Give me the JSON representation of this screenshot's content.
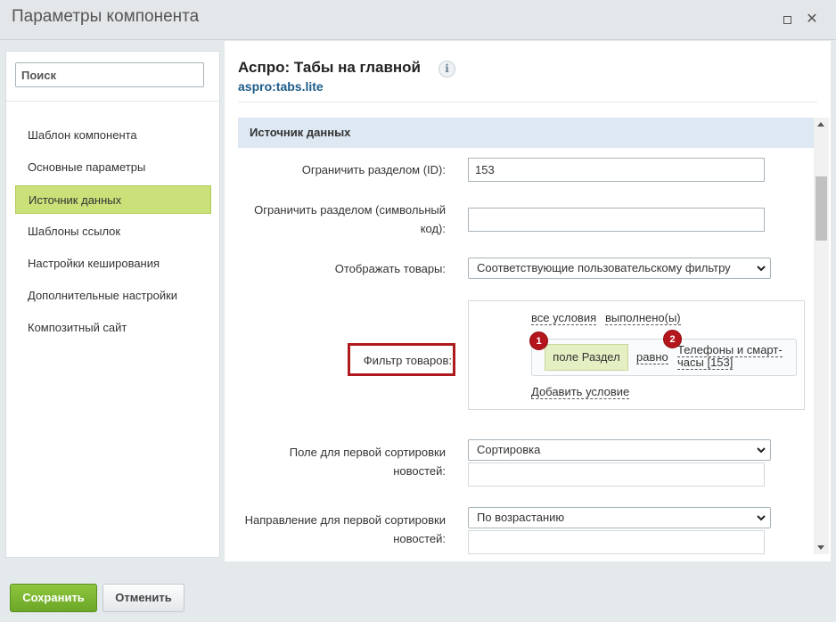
{
  "window": {
    "title": "Параметры компонента"
  },
  "sidebar": {
    "search_placeholder": "Поиск",
    "items": [
      {
        "label": "Шаблон компонента",
        "active": false
      },
      {
        "label": "Основные параметры",
        "active": false
      },
      {
        "label": "Источник данных",
        "active": true
      },
      {
        "label": "Шаблоны ссылок",
        "active": false
      },
      {
        "label": "Настройки кеширования",
        "active": false
      },
      {
        "label": "Дополнительные настройки",
        "active": false
      },
      {
        "label": "Композитный сайт",
        "active": false
      }
    ]
  },
  "component": {
    "title": "Аспро: Табы на главной",
    "code": "aspro:tabs.lite",
    "info_icon": "info-icon"
  },
  "section": {
    "title": "Источник данных"
  },
  "fields": {
    "section_id": {
      "label": "Ограничить разделом (ID):",
      "value": "153"
    },
    "section_code": {
      "label": "Ограничить разделом (символьный код):",
      "value": ""
    },
    "show_products": {
      "label": "Отображать товары:",
      "value": "Соответствующие пользовательскому фильтру"
    },
    "filter": {
      "label": "Фильтр товаров:",
      "all_conditions": "все условия",
      "fulfilled": "выполнено(ы)",
      "field": "поле Раздел",
      "operator": "равно",
      "value": "Телефоны и смарт-часы [153]",
      "add_condition": "Добавить условие",
      "badge1": "1",
      "badge2": "2"
    },
    "sort1_field": {
      "label": "Поле для первой сортировки новостей:",
      "value": "Сортировка"
    },
    "sort1_dir": {
      "label": "Направление для первой сортировки новостей:",
      "value": "По возрастанию"
    }
  },
  "footer": {
    "save_label": "Сохранить",
    "cancel_label": "Отменить"
  },
  "colors": {
    "accent_green": "#8ec73f",
    "active_item": "#c9e178",
    "highlight_red": "#ae1a1e",
    "code_blue": "#1c5b88"
  }
}
